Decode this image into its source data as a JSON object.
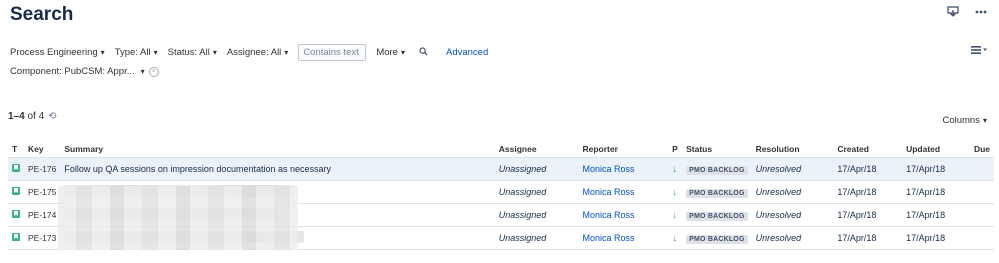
{
  "page": {
    "title": "Search"
  },
  "filters": {
    "project": "Process Engineering",
    "type": "Type: All",
    "status": "Status: All",
    "assignee": "Assignee: All",
    "search_placeholder": "Contains text",
    "more": "More",
    "advanced": "Advanced",
    "component": "Component: PubCSM: Appr..."
  },
  "results": {
    "count_prefix": "1–4",
    "count_suffix": "of 4",
    "columns_label": "Columns"
  },
  "table": {
    "headers": {
      "t": "T",
      "key": "Key",
      "summary": "Summary",
      "assignee": "Assignee",
      "reporter": "Reporter",
      "p": "P",
      "status": "Status",
      "resolution": "Resolution",
      "created": "Created",
      "updated": "Updated",
      "due": "Due"
    },
    "rows": [
      {
        "key": "PE-176",
        "summary": "Follow up QA sessions on impression documentation as necessary",
        "assignee": "Unassigned",
        "reporter": "Monica Ross",
        "status": "PMO BACKLOG",
        "resolution": "Unresolved",
        "created": "17/Apr/18",
        "updated": "17/Apr/18",
        "due": ""
      },
      {
        "key": "PE-175",
        "summary": "",
        "assignee": "Unassigned",
        "reporter": "Monica Ross",
        "status": "PMO BACKLOG",
        "resolution": "Unresolved",
        "created": "17/Apr/18",
        "updated": "17/Apr/18",
        "due": ""
      },
      {
        "key": "PE-174",
        "summary": "",
        "assignee": "Unassigned",
        "reporter": "Monica Ross",
        "status": "PMO BACKLOG",
        "resolution": "Unresolved",
        "created": "17/Apr/18",
        "updated": "17/Apr/18",
        "due": ""
      },
      {
        "key": "PE-173",
        "summary": "",
        "assignee": "Unassigned",
        "reporter": "Monica Ross",
        "status": "PMO BACKLOG",
        "resolution": "Unresolved",
        "created": "17/Apr/18",
        "updated": "17/Apr/18",
        "due": ""
      }
    ]
  },
  "icons": {
    "export": "export-icon",
    "more": "more-actions-icon",
    "search": "search-icon",
    "view_menu": "list-view-icon",
    "refresh": "refresh-icon",
    "issue_type": "story-icon",
    "priority": "priority-low-icon"
  }
}
